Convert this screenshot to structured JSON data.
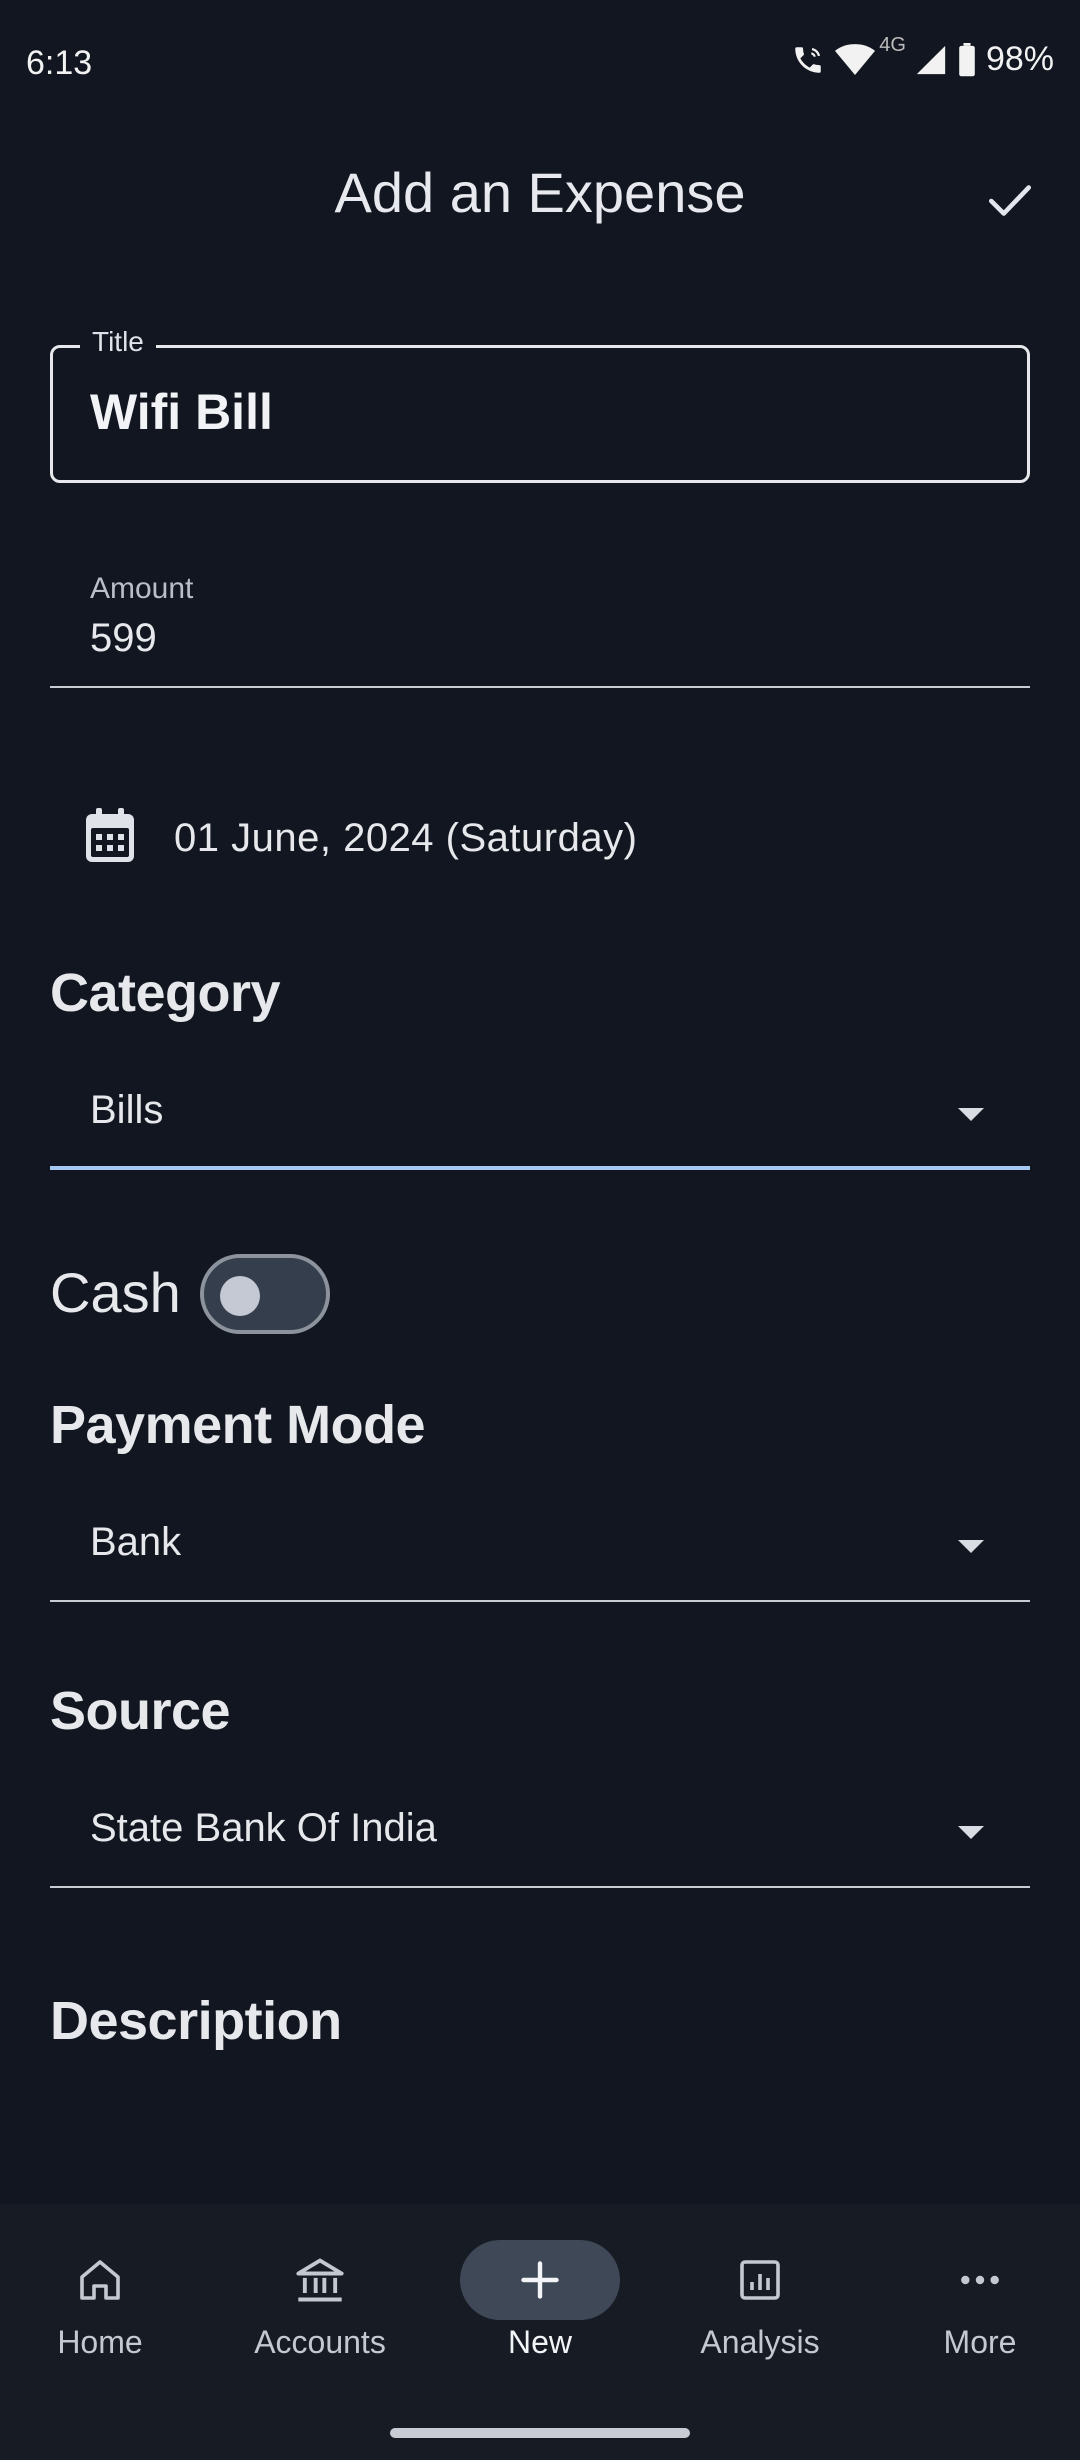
{
  "status_bar": {
    "time": "6:13",
    "network": "4G",
    "battery": "98%"
  },
  "header": {
    "title": "Add an Expense",
    "confirm_icon": "check-icon"
  },
  "form": {
    "title": {
      "label": "Title",
      "value": "Wifi Bill"
    },
    "amount": {
      "label": "Amount",
      "value": "599"
    },
    "date": {
      "value": "01 June, 2024 (Saturday)",
      "icon": "calendar-icon"
    },
    "category": {
      "label": "Category",
      "value": "Bills"
    },
    "cash": {
      "label": "Cash",
      "on": false
    },
    "payment_mode": {
      "label": "Payment Mode",
      "value": "Bank"
    },
    "source": {
      "label": "Source",
      "value": "State Bank Of India"
    },
    "description": {
      "label": "Description"
    }
  },
  "colors": {
    "background": "#111620",
    "focus_accent": "#a8c8f4",
    "nav_active_pill": "#3e4857"
  },
  "bottom_nav": {
    "items": [
      {
        "label": "Home",
        "icon": "home-icon"
      },
      {
        "label": "Accounts",
        "icon": "bank-icon"
      },
      {
        "label": "New",
        "icon": "plus-icon",
        "active": true
      },
      {
        "label": "Analysis",
        "icon": "analytics-icon"
      },
      {
        "label": "More",
        "icon": "more-horizontal-icon"
      }
    ]
  }
}
